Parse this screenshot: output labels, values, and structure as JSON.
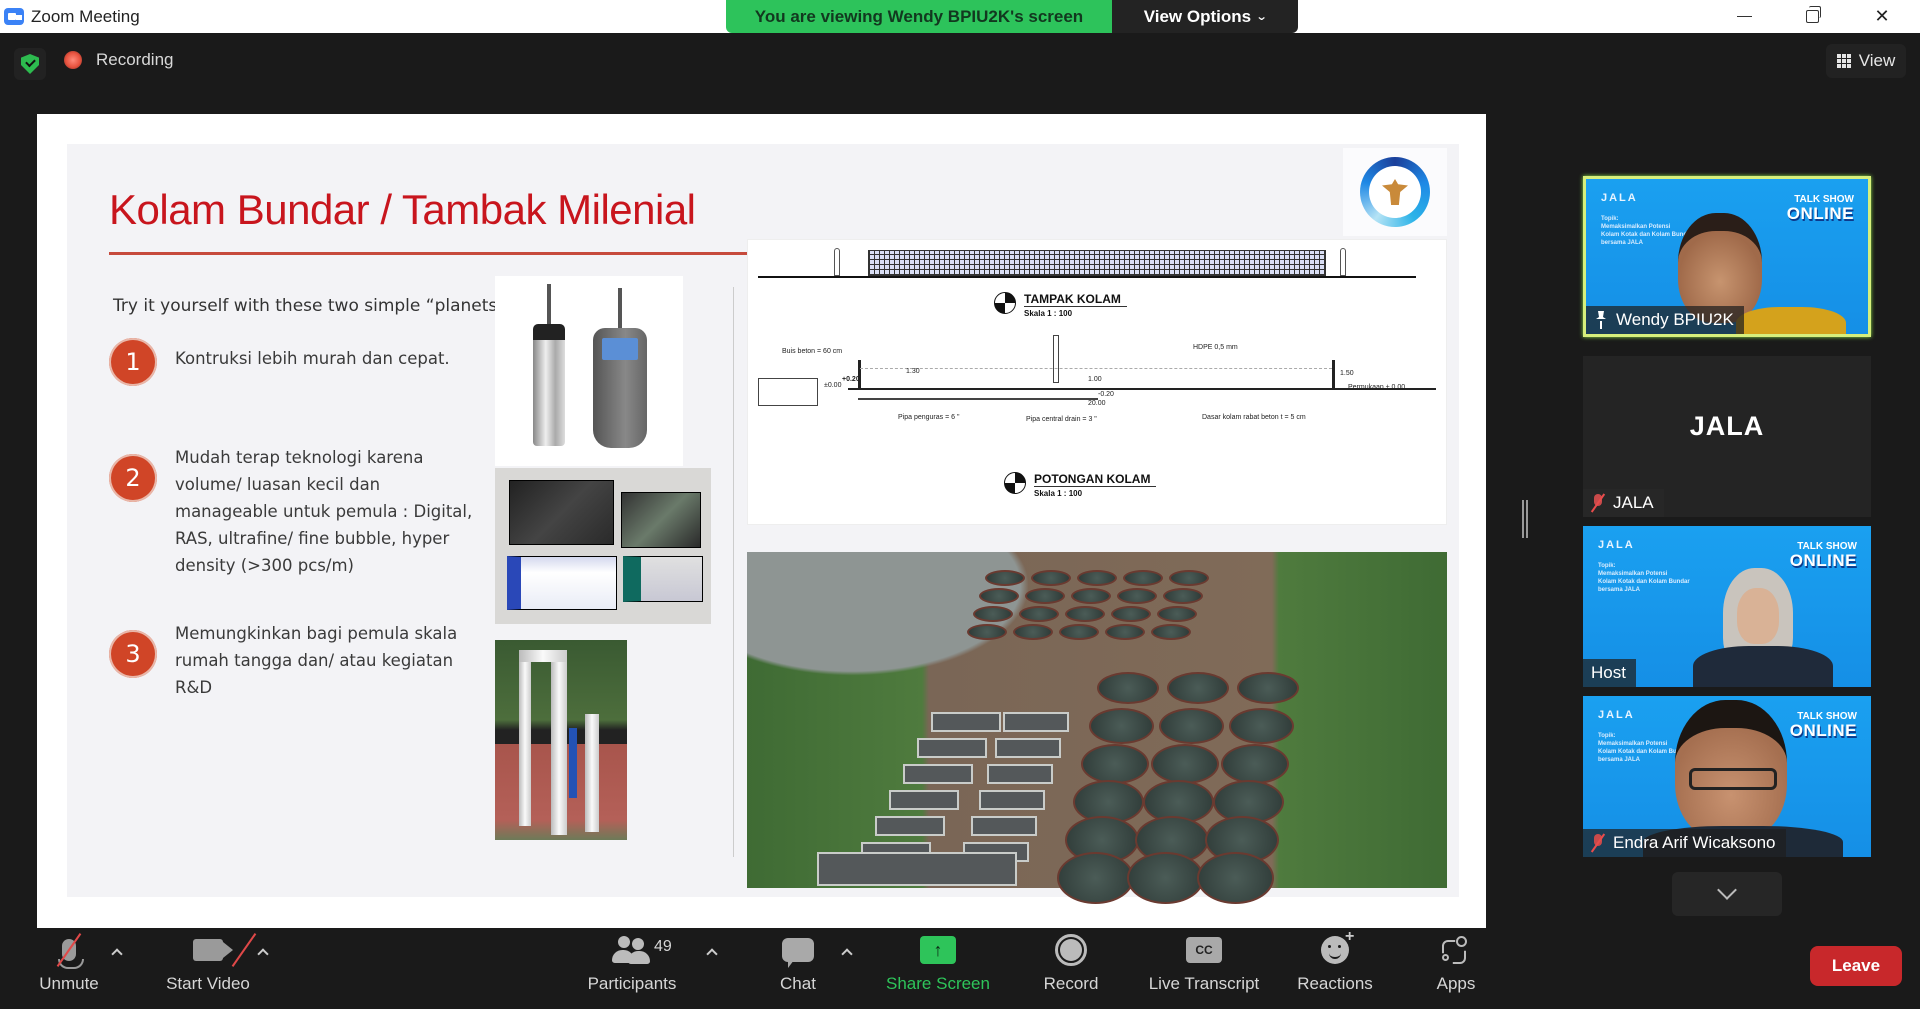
{
  "window": {
    "title": "Zoom Meeting",
    "controls": {
      "minimize": "minimize",
      "maximize": "restore",
      "close": "close"
    }
  },
  "banner": {
    "viewing_text": "You are viewing Wendy BPIU2K's screen",
    "view_options_label": "View Options",
    "accent_color": "#2dc35b"
  },
  "meeting_bar": {
    "security_icon": "shield-check-icon",
    "recording_label": "Recording",
    "view_label": "View"
  },
  "slide": {
    "title": "Kolam Bundar / Tambak Milenial",
    "title_color": "#c8151d",
    "intro": "Try it yourself with these two simple “planets”:",
    "points": [
      {
        "number": "1",
        "text": "Kontruksi lebih murah dan cepat."
      },
      {
        "number": "2",
        "text": "Mudah terap teknologi karena volume/ luasan kecil dan manageable untuk pemula : Digital, RAS, ultrafine/ fine bubble, hyper density (>300 pcs/m)"
      },
      {
        "number": "3",
        "text": "Memungkinkan bagi pemula skala rumah tangga dan/ atau kegiatan R&D"
      }
    ],
    "images": [
      "water-quality-sensor-photo",
      "monitoring-screens-photo",
      "pipe-installation-photo",
      "pond-technical-drawing",
      "aerial-pond-photo"
    ],
    "drawing": {
      "view_label": "TAMPAK KOLAM",
      "view_scale": "Skala 1  :  100",
      "section_label": "POTONGAN KOLAM",
      "section_scale": "Skala 1  :  100",
      "annotations": {
        "buis": "Buis beton = 60 cm",
        "hdpe": "HDPE 0,5 mm",
        "h130": "1.30",
        "h150": "1.50",
        "w100": "1.00",
        "plus020": "+0.20",
        "pm000": "±0.00",
        "minus020": "-0.20",
        "width": "20.00",
        "ground": "Permukaan ± 0.00",
        "pipe_drain": "Pipa penguras = 6 \"",
        "pipe_central": "Pipa central drain = 3 \"",
        "base": "Dasar kolam rabat beton t = 5 cm"
      }
    }
  },
  "participants": [
    {
      "name": "Wendy BPIU2K",
      "status_icon": "pin-icon",
      "active_speaker": true,
      "video": true
    },
    {
      "name": "JALA",
      "status_icon": "muted-mic-icon",
      "active_speaker": false,
      "video": false,
      "display_text": "JALA"
    },
    {
      "name": "Host",
      "status_icon": "",
      "active_speaker": false,
      "video": true
    },
    {
      "name": "Endra Arif Wicaksono",
      "status_icon": "muted-mic-icon",
      "active_speaker": false,
      "video": true
    }
  ],
  "virtual_background": {
    "brand": "JALA",
    "topic_lines": [
      "Topik:",
      "Memaksimalkan Potensi",
      "Kolam Kotak dan Kolam Bundar",
      "bersama JALA"
    ],
    "talkshow_line1": "TALK SHOW",
    "talkshow_line2": "ONLINE"
  },
  "toolbar": {
    "unmute": "Unmute",
    "start_video": "Start Video",
    "participants": "Participants",
    "participant_count": "49",
    "chat": "Chat",
    "share_screen": "Share Screen",
    "record": "Record",
    "live_transcript": "Live Transcript",
    "cc": "CC",
    "reactions": "Reactions",
    "apps": "Apps",
    "leave": "Leave",
    "leave_color": "#c8282b"
  }
}
